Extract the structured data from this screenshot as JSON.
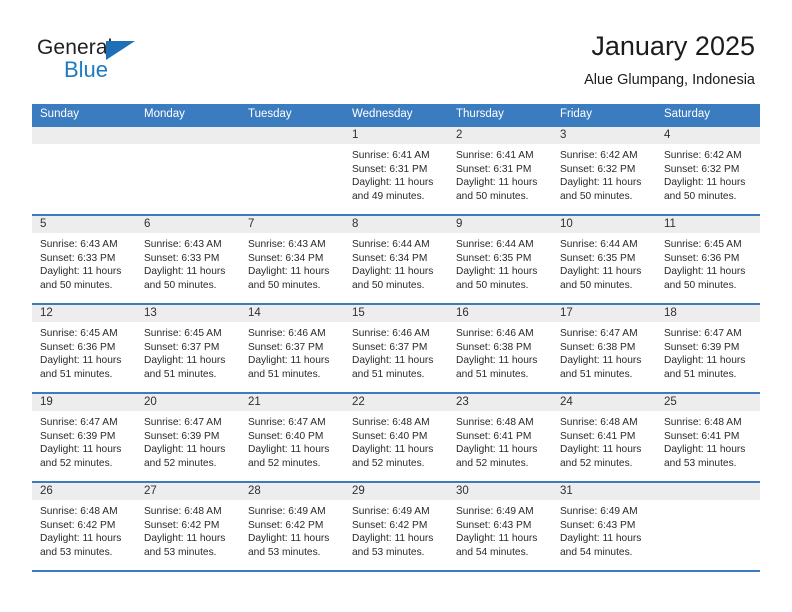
{
  "brand": {
    "name_part1": "General",
    "name_part2": "Blue",
    "accent_color": "#1f7ac0"
  },
  "header": {
    "title": "January 2025",
    "location": "Alue Glumpang, Indonesia"
  },
  "theme": {
    "header_blue": "#3b7cc0",
    "day_band_gray": "#ededed",
    "text_color": "#2a2a2a"
  },
  "weekdays": [
    "Sunday",
    "Monday",
    "Tuesday",
    "Wednesday",
    "Thursday",
    "Friday",
    "Saturday"
  ],
  "weeks": [
    [
      {
        "day": "",
        "sunrise": "",
        "sunset": "",
        "daylight_line1": "",
        "daylight_line2": ""
      },
      {
        "day": "",
        "sunrise": "",
        "sunset": "",
        "daylight_line1": "",
        "daylight_line2": ""
      },
      {
        "day": "",
        "sunrise": "",
        "sunset": "",
        "daylight_line1": "",
        "daylight_line2": ""
      },
      {
        "day": "1",
        "sunrise": "Sunrise: 6:41 AM",
        "sunset": "Sunset: 6:31 PM",
        "daylight_line1": "Daylight: 11 hours",
        "daylight_line2": "and 49 minutes."
      },
      {
        "day": "2",
        "sunrise": "Sunrise: 6:41 AM",
        "sunset": "Sunset: 6:31 PM",
        "daylight_line1": "Daylight: 11 hours",
        "daylight_line2": "and 50 minutes."
      },
      {
        "day": "3",
        "sunrise": "Sunrise: 6:42 AM",
        "sunset": "Sunset: 6:32 PM",
        "daylight_line1": "Daylight: 11 hours",
        "daylight_line2": "and 50 minutes."
      },
      {
        "day": "4",
        "sunrise": "Sunrise: 6:42 AM",
        "sunset": "Sunset: 6:32 PM",
        "daylight_line1": "Daylight: 11 hours",
        "daylight_line2": "and 50 minutes."
      }
    ],
    [
      {
        "day": "5",
        "sunrise": "Sunrise: 6:43 AM",
        "sunset": "Sunset: 6:33 PM",
        "daylight_line1": "Daylight: 11 hours",
        "daylight_line2": "and 50 minutes."
      },
      {
        "day": "6",
        "sunrise": "Sunrise: 6:43 AM",
        "sunset": "Sunset: 6:33 PM",
        "daylight_line1": "Daylight: 11 hours",
        "daylight_line2": "and 50 minutes."
      },
      {
        "day": "7",
        "sunrise": "Sunrise: 6:43 AM",
        "sunset": "Sunset: 6:34 PM",
        "daylight_line1": "Daylight: 11 hours",
        "daylight_line2": "and 50 minutes."
      },
      {
        "day": "8",
        "sunrise": "Sunrise: 6:44 AM",
        "sunset": "Sunset: 6:34 PM",
        "daylight_line1": "Daylight: 11 hours",
        "daylight_line2": "and 50 minutes."
      },
      {
        "day": "9",
        "sunrise": "Sunrise: 6:44 AM",
        "sunset": "Sunset: 6:35 PM",
        "daylight_line1": "Daylight: 11 hours",
        "daylight_line2": "and 50 minutes."
      },
      {
        "day": "10",
        "sunrise": "Sunrise: 6:44 AM",
        "sunset": "Sunset: 6:35 PM",
        "daylight_line1": "Daylight: 11 hours",
        "daylight_line2": "and 50 minutes."
      },
      {
        "day": "11",
        "sunrise": "Sunrise: 6:45 AM",
        "sunset": "Sunset: 6:36 PM",
        "daylight_line1": "Daylight: 11 hours",
        "daylight_line2": "and 50 minutes."
      }
    ],
    [
      {
        "day": "12",
        "sunrise": "Sunrise: 6:45 AM",
        "sunset": "Sunset: 6:36 PM",
        "daylight_line1": "Daylight: 11 hours",
        "daylight_line2": "and 51 minutes."
      },
      {
        "day": "13",
        "sunrise": "Sunrise: 6:45 AM",
        "sunset": "Sunset: 6:37 PM",
        "daylight_line1": "Daylight: 11 hours",
        "daylight_line2": "and 51 minutes."
      },
      {
        "day": "14",
        "sunrise": "Sunrise: 6:46 AM",
        "sunset": "Sunset: 6:37 PM",
        "daylight_line1": "Daylight: 11 hours",
        "daylight_line2": "and 51 minutes."
      },
      {
        "day": "15",
        "sunrise": "Sunrise: 6:46 AM",
        "sunset": "Sunset: 6:37 PM",
        "daylight_line1": "Daylight: 11 hours",
        "daylight_line2": "and 51 minutes."
      },
      {
        "day": "16",
        "sunrise": "Sunrise: 6:46 AM",
        "sunset": "Sunset: 6:38 PM",
        "daylight_line1": "Daylight: 11 hours",
        "daylight_line2": "and 51 minutes."
      },
      {
        "day": "17",
        "sunrise": "Sunrise: 6:47 AM",
        "sunset": "Sunset: 6:38 PM",
        "daylight_line1": "Daylight: 11 hours",
        "daylight_line2": "and 51 minutes."
      },
      {
        "day": "18",
        "sunrise": "Sunrise: 6:47 AM",
        "sunset": "Sunset: 6:39 PM",
        "daylight_line1": "Daylight: 11 hours",
        "daylight_line2": "and 51 minutes."
      }
    ],
    [
      {
        "day": "19",
        "sunrise": "Sunrise: 6:47 AM",
        "sunset": "Sunset: 6:39 PM",
        "daylight_line1": "Daylight: 11 hours",
        "daylight_line2": "and 52 minutes."
      },
      {
        "day": "20",
        "sunrise": "Sunrise: 6:47 AM",
        "sunset": "Sunset: 6:39 PM",
        "daylight_line1": "Daylight: 11 hours",
        "daylight_line2": "and 52 minutes."
      },
      {
        "day": "21",
        "sunrise": "Sunrise: 6:47 AM",
        "sunset": "Sunset: 6:40 PM",
        "daylight_line1": "Daylight: 11 hours",
        "daylight_line2": "and 52 minutes."
      },
      {
        "day": "22",
        "sunrise": "Sunrise: 6:48 AM",
        "sunset": "Sunset: 6:40 PM",
        "daylight_line1": "Daylight: 11 hours",
        "daylight_line2": "and 52 minutes."
      },
      {
        "day": "23",
        "sunrise": "Sunrise: 6:48 AM",
        "sunset": "Sunset: 6:41 PM",
        "daylight_line1": "Daylight: 11 hours",
        "daylight_line2": "and 52 minutes."
      },
      {
        "day": "24",
        "sunrise": "Sunrise: 6:48 AM",
        "sunset": "Sunset: 6:41 PM",
        "daylight_line1": "Daylight: 11 hours",
        "daylight_line2": "and 52 minutes."
      },
      {
        "day": "25",
        "sunrise": "Sunrise: 6:48 AM",
        "sunset": "Sunset: 6:41 PM",
        "daylight_line1": "Daylight: 11 hours",
        "daylight_line2": "and 53 minutes."
      }
    ],
    [
      {
        "day": "26",
        "sunrise": "Sunrise: 6:48 AM",
        "sunset": "Sunset: 6:42 PM",
        "daylight_line1": "Daylight: 11 hours",
        "daylight_line2": "and 53 minutes."
      },
      {
        "day": "27",
        "sunrise": "Sunrise: 6:48 AM",
        "sunset": "Sunset: 6:42 PM",
        "daylight_line1": "Daylight: 11 hours",
        "daylight_line2": "and 53 minutes."
      },
      {
        "day": "28",
        "sunrise": "Sunrise: 6:49 AM",
        "sunset": "Sunset: 6:42 PM",
        "daylight_line1": "Daylight: 11 hours",
        "daylight_line2": "and 53 minutes."
      },
      {
        "day": "29",
        "sunrise": "Sunrise: 6:49 AM",
        "sunset": "Sunset: 6:42 PM",
        "daylight_line1": "Daylight: 11 hours",
        "daylight_line2": "and 53 minutes."
      },
      {
        "day": "30",
        "sunrise": "Sunrise: 6:49 AM",
        "sunset": "Sunset: 6:43 PM",
        "daylight_line1": "Daylight: 11 hours",
        "daylight_line2": "and 54 minutes."
      },
      {
        "day": "31",
        "sunrise": "Sunrise: 6:49 AM",
        "sunset": "Sunset: 6:43 PM",
        "daylight_line1": "Daylight: 11 hours",
        "daylight_line2": "and 54 minutes."
      },
      {
        "day": "",
        "sunrise": "",
        "sunset": "",
        "daylight_line1": "",
        "daylight_line2": ""
      }
    ]
  ]
}
